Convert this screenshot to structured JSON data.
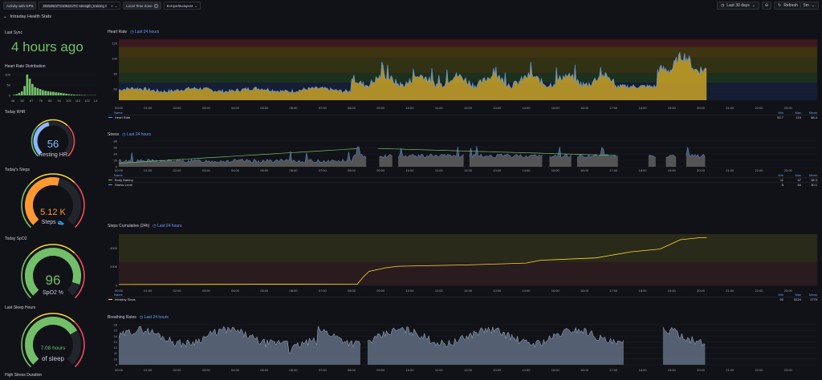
{
  "topbar": {
    "gps_label": "Activity with GPS",
    "gps_value": "20250502T210622UTC-strength_training",
    "tz_label": "Local Time Zone",
    "tz_value": "Europe/Budapest",
    "time_range": "Last 30 days",
    "refresh_label": "Refresh",
    "refresh_interval": "5m"
  },
  "row": {
    "title": "Intraday Health Stats"
  },
  "last_sync": {
    "title": "Last Sync",
    "value": "4 hours ago"
  },
  "hr_dist": {
    "title": "Heart Rate Distribution",
    "yticks": [
      "100",
      "50",
      "0"
    ],
    "xticks": [
      "48",
      "58",
      "67",
      "76",
      "85",
      "94",
      "103",
      "113",
      "122",
      "131"
    ],
    "bars": [
      3,
      6,
      12,
      20,
      45,
      100,
      80,
      55,
      40,
      35,
      30,
      25,
      22,
      20,
      18,
      17,
      15,
      14,
      12,
      10,
      8,
      6,
      5,
      4,
      3,
      3,
      2,
      2,
      1,
      1,
      1,
      1
    ]
  },
  "rhr": {
    "title": "Today RHR",
    "value": "56",
    "unit": "Resting HR",
    "fraction": 0.45,
    "color": "#8ab8ff"
  },
  "steps": {
    "title": "Today's Steps",
    "value": "5.12 K",
    "unit": "Steps 👟",
    "fraction": 0.55,
    "color": "#ff9830"
  },
  "spo2": {
    "title": "Today SpO2",
    "value": "96",
    "unit": "SpO2 %",
    "fraction": 0.9,
    "color": "#73bf69"
  },
  "sleep": {
    "title": "Last Sleep Hours",
    "value": "7.08 hours",
    "unit": "of sleep",
    "fraction": 0.72,
    "color": "#73bf69"
  },
  "stress_dur": {
    "title": "High Stress Duration"
  },
  "time_ticks": [
    "00:00",
    "01:00",
    "02:00",
    "03:00",
    "04:00",
    "05:00",
    "06:00",
    "07:00",
    "08:00",
    "09:00",
    "10:00",
    "11:00",
    "12:00",
    "13:00",
    "14:00",
    "15:00",
    "16:00",
    "17:00",
    "18:00",
    "19:00",
    "20:00",
    "21:00",
    "22:00",
    "23:00"
  ],
  "charts": {
    "range_label": "Last 24 hours",
    "legend_headers": {
      "name": "Name",
      "min": "Min",
      "max": "Max",
      "mean": "Mean"
    },
    "hr": {
      "title": "Heart Rate",
      "yticks": [
        "120",
        "100",
        "80",
        "60"
      ],
      "series": [
        {
          "name": "Heart Rate",
          "min": "53.7",
          "max": "119",
          "mean": "68.4",
          "color": "#5794f2"
        }
      ]
    },
    "stress": {
      "title": "Stress",
      "yticks": [
        "80",
        "60",
        "40",
        "20",
        "0"
      ],
      "series": [
        {
          "name": "Body Battery",
          "min": "11",
          "max": "57",
          "mean": "38.3",
          "color": "#73bf69"
        },
        {
          "name": "Stress Level",
          "min": "8",
          "max": "84",
          "mean": "30.1",
          "color": "#5794f2"
        }
      ]
    },
    "steps": {
      "title": "Steps Cumulative (24h)",
      "yticks": [
        "4000",
        "2000",
        "0"
      ],
      "series": [
        {
          "name": "Intraday Steps",
          "min": "92",
          "max": "5124",
          "mean": "1775",
          "color": "#fade2a"
        }
      ]
    },
    "breath": {
      "title": "Breathing Rates",
      "yticks": [
        "16",
        "15",
        "14",
        "13",
        "12",
        "11",
        "10",
        "9"
      ]
    }
  }
}
